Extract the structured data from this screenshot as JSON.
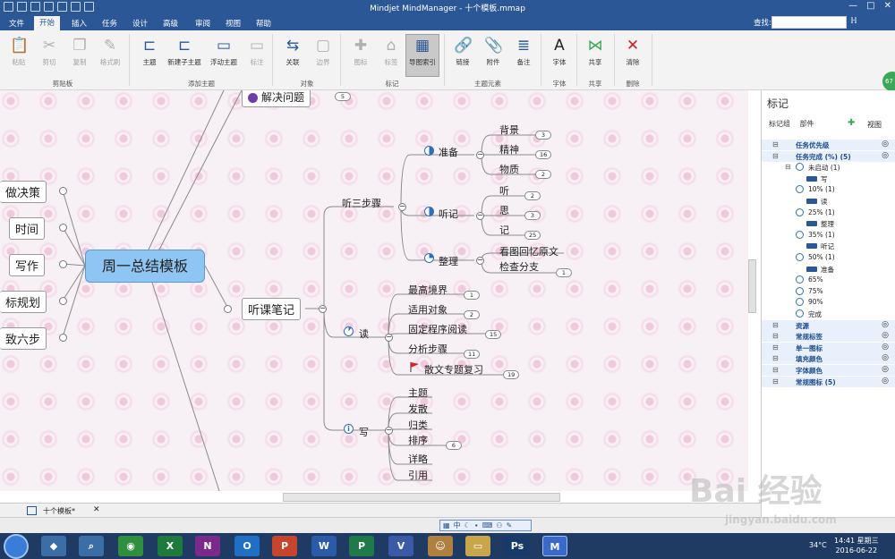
{
  "window": {
    "title": "Mindjet MindManager - 十个模板.mmap"
  },
  "menu": {
    "tabs": [
      "文件",
      "开始",
      "插入",
      "任务",
      "设计",
      "高级",
      "审阅",
      "视图",
      "帮助"
    ],
    "active": "开始",
    "find_label": "查找:",
    "help_icon": "help-icon"
  },
  "ribbon": {
    "clipboard": {
      "paste": "粘贴",
      "cut": "剪切",
      "copy": "复制",
      "format_painter": "格式刷",
      "group": "剪贴板"
    },
    "add_topic": {
      "topic": "主题",
      "subtopic": "新建子主题",
      "floating": "浮动主题",
      "callout": "标注",
      "group": "添加主题"
    },
    "objects": {
      "relation": "关联",
      "boundary": "边界",
      "group": "对象"
    },
    "markers": {
      "icon": "图标",
      "tag": "标签",
      "marker_index": "导图索引",
      "group": "标记"
    },
    "elements": {
      "link": "链接",
      "attach": "附件",
      "note": "备注",
      "group": "主题元素"
    },
    "font": {
      "font": "字体",
      "group": "字体"
    },
    "share": {
      "share": "共享",
      "group": "共享"
    },
    "delete": {
      "clear": "清除",
      "group": "删除"
    },
    "badge": "67"
  },
  "map": {
    "central": "周一总结模板",
    "left_topics": [
      "做决策",
      "时间",
      "写作",
      "标规划",
      "致六步"
    ],
    "top_topic": "解决问题",
    "top_topic_count": "5",
    "main": "听课笔记",
    "branch_a": "听三步骤",
    "prepare": {
      "label": "准备",
      "items": [
        {
          "t": "背景",
          "c": "3"
        },
        {
          "t": "精神",
          "c": "16"
        },
        {
          "t": "物质",
          "c": "2"
        }
      ]
    },
    "listen": {
      "label": "听记",
      "items": [
        {
          "t": "听",
          "c": "2"
        },
        {
          "t": "思",
          "c": "3"
        },
        {
          "t": "记",
          "c": "25"
        }
      ]
    },
    "organize": {
      "label": "整理",
      "items": [
        {
          "t": "看图回忆原文",
          "c": ""
        },
        {
          "t": "检查分支",
          "c": "1"
        }
      ]
    },
    "read": {
      "label": "读",
      "items": [
        {
          "t": "最高境界",
          "c": "1"
        },
        {
          "t": "适用对象",
          "c": "2"
        },
        {
          "t": "固定程序阅读",
          "c": "15"
        },
        {
          "t": "分析步骤",
          "c": "11"
        },
        {
          "t": "散文专题复习",
          "c": "19"
        }
      ]
    },
    "write": {
      "label": "写",
      "items": [
        "主题",
        "发散",
        "归类",
        "排序",
        "详略",
        "引用"
      ],
      "count": "6"
    }
  },
  "panel": {
    "title": "标记",
    "tabs": [
      "标记组",
      "部件"
    ],
    "view": "视图",
    "rows": [
      {
        "label": "任务优先级",
        "type": "group"
      },
      {
        "label": "任务完成 (%) (5)",
        "type": "group"
      },
      {
        "label": "未启动 (1)",
        "type": "item"
      },
      {
        "label": "写",
        "type": "sub"
      },
      {
        "label": "10% (1)",
        "type": "item"
      },
      {
        "label": "读",
        "type": "sub"
      },
      {
        "label": "25% (1)",
        "type": "item"
      },
      {
        "label": "整理",
        "type": "sub"
      },
      {
        "label": "35% (1)",
        "type": "item"
      },
      {
        "label": "听记",
        "type": "sub"
      },
      {
        "label": "50% (1)",
        "type": "item"
      },
      {
        "label": "准备",
        "type": "sub"
      },
      {
        "label": "65%",
        "type": "item"
      },
      {
        "label": "75%",
        "type": "item"
      },
      {
        "label": "90%",
        "type": "item"
      },
      {
        "label": "完成",
        "type": "item"
      },
      {
        "label": "资源",
        "type": "group"
      },
      {
        "label": "常规标签",
        "type": "group"
      },
      {
        "label": "单一图标",
        "type": "group"
      },
      {
        "label": "填充颜色",
        "type": "group"
      },
      {
        "label": "字体颜色",
        "type": "group"
      },
      {
        "label": "常规图标 (5)",
        "type": "group"
      }
    ]
  },
  "doc_tab": "十个模板*",
  "taskbar": {
    "time": "14:41 星期三",
    "date": "2016-06-22",
    "temp": "34°C",
    "apps": [
      "X",
      "N",
      "O",
      "P",
      "W",
      "P",
      "V",
      "Ps"
    ]
  },
  "watermark": {
    "main": "Bai 经验",
    "sub": "jingyan.baidu.com"
  },
  "colors": {
    "titlebar": "#2b5797",
    "central": "#8fc5f2",
    "pie": "#2e6fb6"
  }
}
